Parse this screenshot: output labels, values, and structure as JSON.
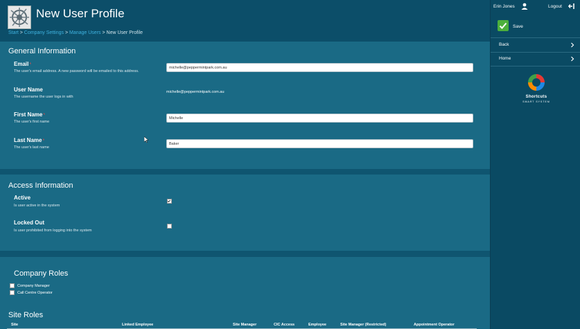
{
  "header": {
    "title": "New User Profile",
    "breadcrumb": [
      {
        "label": "Start"
      },
      {
        "label": "Company Settings"
      },
      {
        "label": "Manage Users"
      },
      {
        "label": "New User Profile"
      }
    ],
    "separator": ">",
    "logo_icon": "company-logo-icon"
  },
  "general": {
    "title": "General Information",
    "email": {
      "label": "Email",
      "required_mark": "*",
      "description": "The user's email address. A new password will be emailed to this address.",
      "value": "michelle@peppermintpark.com.au"
    },
    "username": {
      "label": "User Name",
      "description": "The username the user logs in with",
      "value": "michelle@peppermintpark.com.au"
    },
    "first_name": {
      "label": "First Name",
      "required_mark": "*",
      "description": "The user's first name",
      "value": "Michelle"
    },
    "last_name": {
      "label": "Last Name",
      "required_mark": "*",
      "description": "The user's last name",
      "value": "Baker"
    }
  },
  "access": {
    "title": "Access Information",
    "active": {
      "label": "Active",
      "description": "Is user active in the system",
      "checked": true
    },
    "locked_out": {
      "label": "Locked Out",
      "description": "Is user prohibited from logging into the system",
      "checked": false
    }
  },
  "company_roles": {
    "title": "Company Roles",
    "items": [
      {
        "label": "Company Manager",
        "checked": false
      },
      {
        "label": "Call Centre Operator",
        "checked": false
      }
    ]
  },
  "site_roles": {
    "title": "Site Roles",
    "columns": [
      "Site",
      "Linked Employee",
      "Site Manager",
      "CIC Access",
      "Employee",
      "Site Manager (Restricted)",
      "Appointment Operator"
    ]
  },
  "sidebar": {
    "user_name": "Erin Jones",
    "logout_label": "Logout",
    "save_label": "Save",
    "nav": [
      {
        "label": "Back"
      },
      {
        "label": "Home"
      }
    ],
    "brand_name": "Shortcuts",
    "brand_sub": "SMART SYSTEM"
  },
  "colors": {
    "save_green": "#4caf3c",
    "link_blue": "#3fb3e0",
    "required_red": "#e04848"
  }
}
